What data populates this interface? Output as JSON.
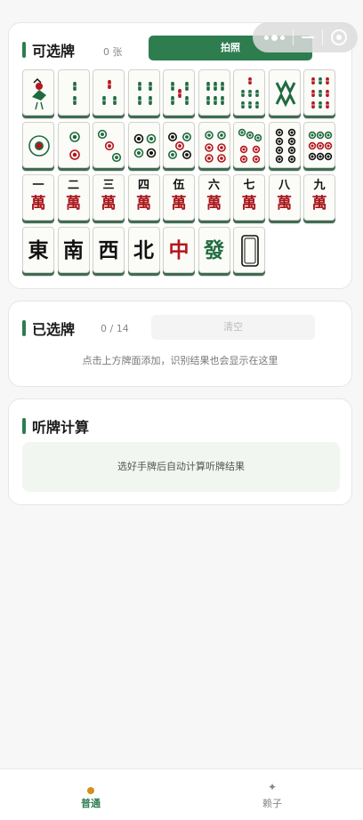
{
  "selectable": {
    "title": "可选牌",
    "count": "0 张",
    "photo_label": "拍照",
    "tile_names": {
      "bamboo": [
        "一条",
        "二条",
        "三条",
        "四条",
        "五条",
        "六条",
        "七条",
        "八条",
        "九条"
      ],
      "dots": [
        "一筒",
        "二筒",
        "三筒",
        "四筒",
        "五筒",
        "六筒",
        "七筒",
        "八筒",
        "九筒"
      ],
      "winds_dragons": [
        "东",
        "南",
        "西",
        "北",
        "中",
        "发",
        "白"
      ]
    },
    "characters": {
      "numerals": [
        "一",
        "二",
        "三",
        "四",
        "伍",
        "六",
        "七",
        "八",
        "九"
      ],
      "suit_char": "萬"
    },
    "honors": {
      "east": "東",
      "south": "南",
      "west": "西",
      "north": "北",
      "red": "中",
      "green": "發"
    }
  },
  "selected": {
    "title": "已选牌",
    "count": "0 / 14",
    "clear_label": "清空",
    "hint": "点击上方牌面添加，识别结果也会显示在这里"
  },
  "ting": {
    "title": "听牌计算",
    "placeholder": "选好手牌后自动计算听牌结果"
  },
  "tabs": [
    {
      "label": "普通",
      "active": true
    },
    {
      "label": "赖子",
      "active": false,
      "icon": "sparkle-icon"
    }
  ],
  "colors": {
    "accent": "#2e7d4f",
    "red": "#a8161a",
    "tab_dot": "#d4901e"
  }
}
